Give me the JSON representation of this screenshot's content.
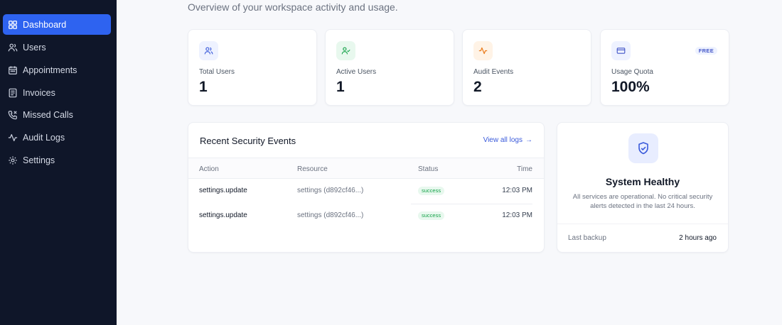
{
  "sidebar": {
    "items": [
      {
        "label": "Dashboard",
        "icon": "dashboard-icon",
        "active": true
      },
      {
        "label": "Users",
        "icon": "users-icon"
      },
      {
        "label": "Appointments",
        "icon": "calendar-icon"
      },
      {
        "label": "Invoices",
        "icon": "invoice-icon"
      },
      {
        "label": "Missed Calls",
        "icon": "missed-call-icon"
      },
      {
        "label": "Audit Logs",
        "icon": "activity-icon"
      },
      {
        "label": "Settings",
        "icon": "gear-icon"
      }
    ]
  },
  "header": {
    "subtitle": "Overview of your workspace activity and usage."
  },
  "stats": [
    {
      "label": "Total Users",
      "value": "1",
      "icon": "users-icon",
      "accent": "#3b5bdb"
    },
    {
      "label": "Active Users",
      "value": "1",
      "icon": "user-check-icon",
      "accent": "#16a34a"
    },
    {
      "label": "Audit Events",
      "value": "2",
      "icon": "activity-icon",
      "accent": "#ea7a1a"
    },
    {
      "label": "Usage Quota",
      "value": "100%",
      "icon": "credit-card-icon",
      "accent": "#4457c8",
      "badge": "FREE"
    }
  ],
  "events": {
    "title": "Recent Security Events",
    "view_all": "View all logs",
    "columns": {
      "action": "Action",
      "resource": "Resource",
      "status": "Status",
      "time": "Time"
    },
    "rows": [
      {
        "action": "settings.update",
        "resource": "settings (d892cf46...)",
        "status": "success",
        "time": "12:03 PM"
      },
      {
        "action": "settings.update",
        "resource": "settings (d892cf46...)",
        "status": "success",
        "time": "12:03 PM"
      }
    ]
  },
  "health": {
    "title": "System Healthy",
    "description": "All services are operational. No critical security alerts detected in the last 24 hours.",
    "backup_label": "Last backup",
    "backup_value": "2 hours ago",
    "icon": "shield-check-icon"
  },
  "colors": {
    "sidebar_bg": "#0f1629",
    "active_nav": "#2e63f0",
    "page_bg": "#f7f8fb",
    "success": "#16a34a",
    "link": "#3b5bdb"
  }
}
